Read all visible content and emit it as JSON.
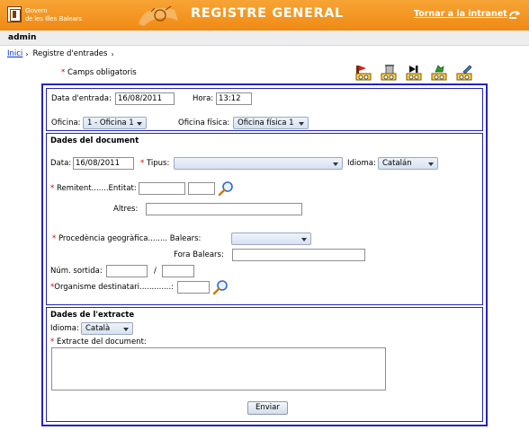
{
  "header": {
    "org_line1": "Govern",
    "org_line2": "de les Illes Balears",
    "app_title": "REGISTRE GENERAL",
    "intranet_link": "Tornar a la intranet",
    "colors": {
      "header_orange": "#f19221",
      "panel_border": "#2424b8",
      "required": "#d40000"
    }
  },
  "user": {
    "name": "admin"
  },
  "breadcrumb": {
    "home": "Inici",
    "separator": "›",
    "current": "Registre d'entrades"
  },
  "required_note": {
    "mark": "*",
    "text": " Camps obligatoris"
  },
  "toolbar": {
    "icons": [
      "new-register-icon",
      "delete-icon",
      "next-icon",
      "recycle-icon",
      "edit-icon"
    ]
  },
  "entry": {
    "date_label": "Data d'entrada:",
    "date_value": "16/08/2011",
    "time_label": "Hora:",
    "time_value": "13:12",
    "office_label": "Oficina:",
    "office_value": "1 - Oficina 1",
    "physical_office_label": "Oficina física:",
    "physical_office_value": "Oficina física 1"
  },
  "document": {
    "section_title": "Dades del document",
    "date_label": "Data:",
    "date_value": "16/08/2011",
    "type_label": "Tipus:",
    "type_value": "",
    "language_label": "Idioma:",
    "language_value": "Catalán",
    "sender_label": "Remitent.......Entitat:",
    "others_label": "Altres:",
    "origin_label": "Procedència geogràfica........ Balears:",
    "origin_balears_value": "",
    "outside_balears_label": "Fora Balears:",
    "exit_number_label": "Núm. sortida:",
    "exit_separator": "/",
    "dest_org_label": "Organisme destinatari.............:"
  },
  "extract": {
    "section_title": "Dades de l'extracte",
    "language_label": "Idioma:",
    "language_value": "Català",
    "extract_label": "Extracte del document:",
    "extract_value": "",
    "submit_label": "Enviar"
  }
}
